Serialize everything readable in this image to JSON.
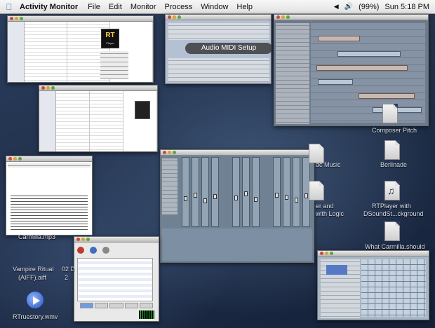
{
  "menubar": {
    "apple_icon": "apple-icon",
    "app_name": "Activity Monitor",
    "menus": [
      "File",
      "Edit",
      "Monitor",
      "Process",
      "Window",
      "Help"
    ],
    "battery": "(99%)",
    "clock": "Sun 5:18 PM"
  },
  "windows": {
    "audio_midi_setup": {
      "title": "Audio MIDI Setup"
    },
    "finder_top": {
      "logo_text": "RT",
      "logo_sub": "Player"
    }
  },
  "desktop_icons": [
    {
      "label": "Composer Pitch"
    },
    {
      "label": "Berlinade"
    },
    {
      "label": "ac Music"
    },
    {
      "label": "RTPlayer with"
    },
    {
      "label": "DSoundSt...ckground"
    },
    {
      "label": "er and"
    },
    {
      "label": "with Logic"
    },
    {
      "label": "What Carmilla.should"
    },
    {
      "label": "Carmilla.mp3"
    },
    {
      "label": "Vampire Ritual"
    },
    {
      "label": "(AIFF).aiff"
    },
    {
      "label": "02 D"
    },
    {
      "label": "2"
    },
    {
      "label": "RTruestory.wmv"
    }
  ],
  "colors": {
    "accent": "#3a6fd2",
    "desktop": "#2b3e5e"
  }
}
